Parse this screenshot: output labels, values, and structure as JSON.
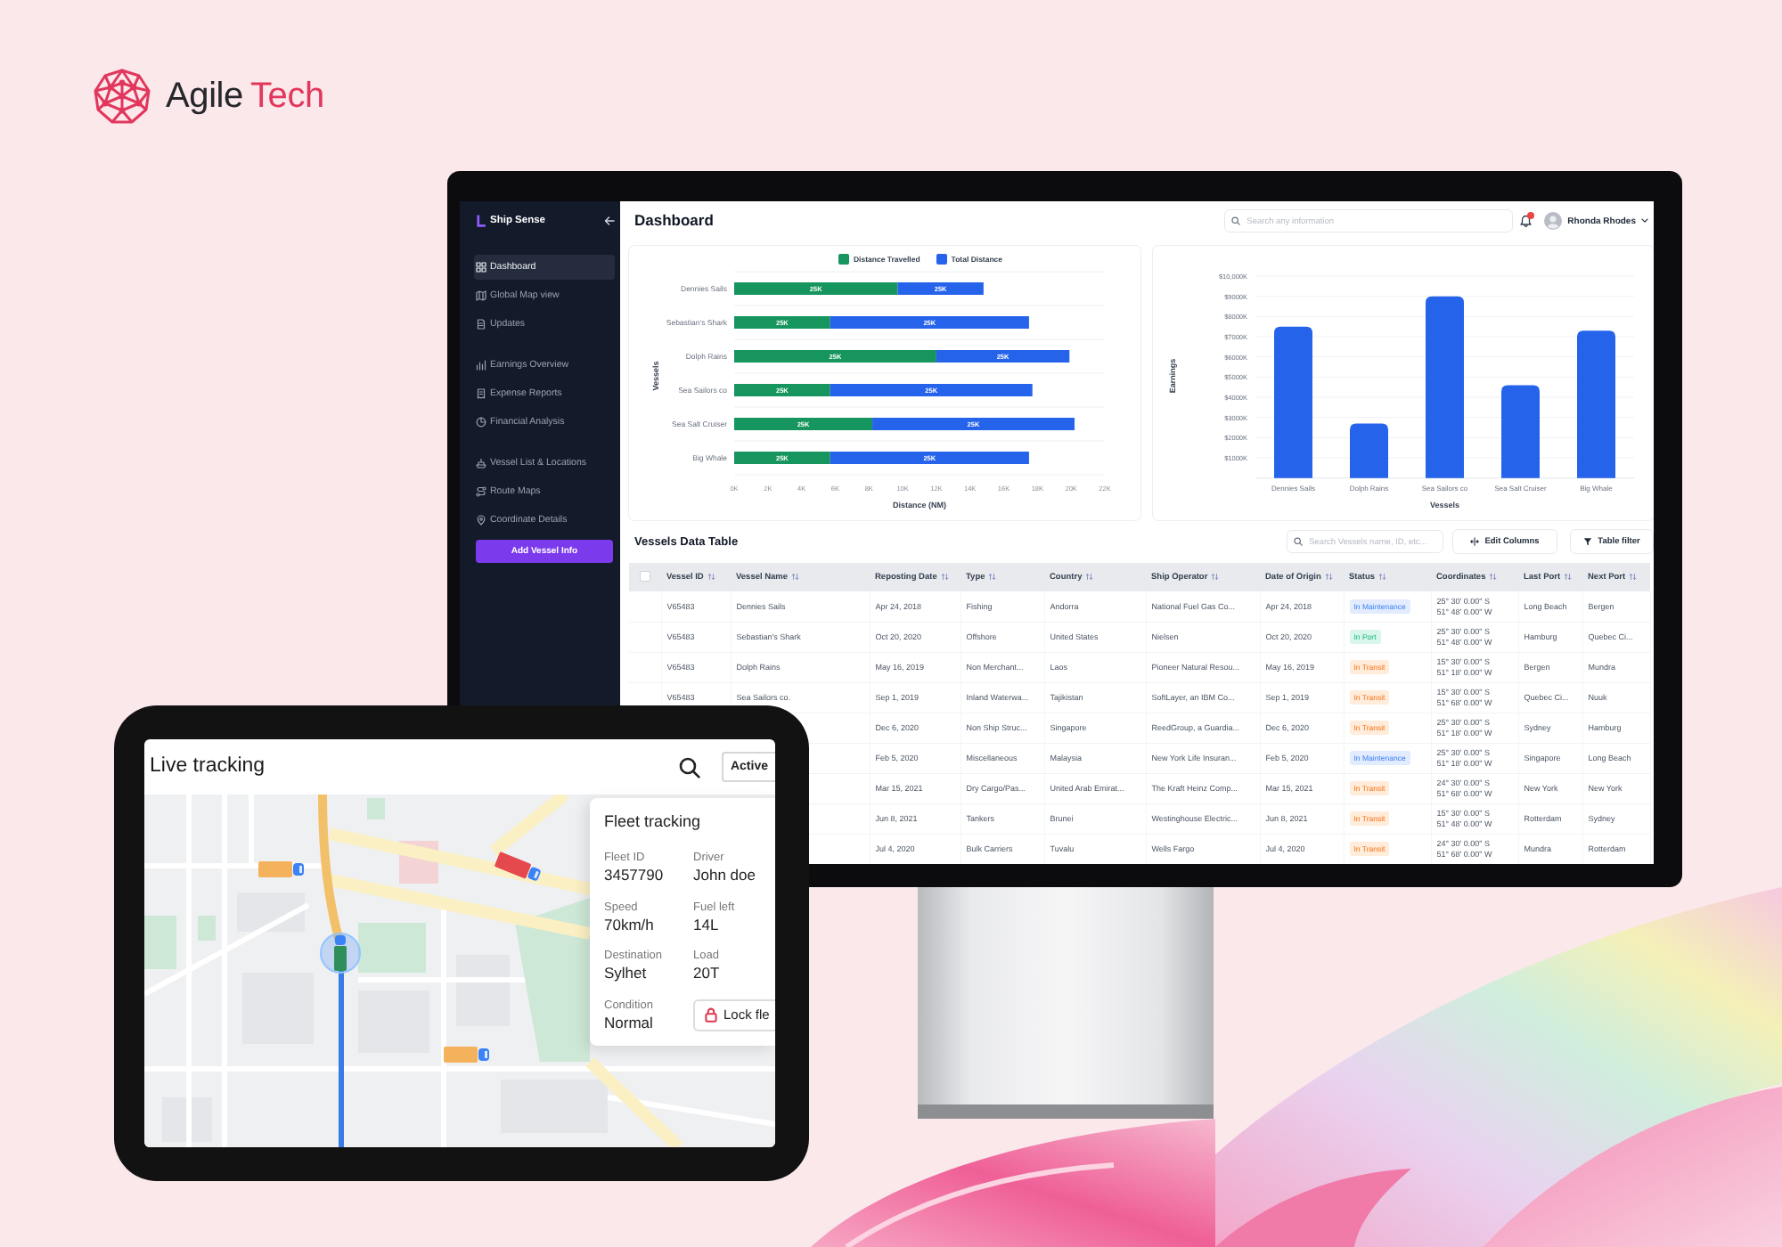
{
  "logo": {
    "words": [
      {
        "text": "Agile",
        "accent": false
      },
      {
        "text": "Tech",
        "accent": true
      }
    ]
  },
  "monitor": {
    "sidebar": {
      "title": "Ship Sense",
      "groups": [
        [
          {
            "label": "Dashboard",
            "selected": true
          },
          {
            "label": "Global Map view",
            "selected": false
          },
          {
            "label": "Updates",
            "selected": false
          }
        ],
        [
          {
            "label": "Earnings Overview",
            "selected": false
          },
          {
            "label": "Expense Reports",
            "selected": false
          },
          {
            "label": "Financial Analysis",
            "selected": false
          }
        ],
        [
          {
            "label": "Vessel List & Locations",
            "selected": false
          },
          {
            "label": "Route Maps",
            "selected": false
          },
          {
            "label": "Coordinate Details",
            "selected": false
          }
        ]
      ],
      "button": "Add Vessel Info"
    },
    "header": {
      "title": "Dashboard",
      "search": {
        "placeholder": "Search any information"
      },
      "notifications": {
        "unread": true
      },
      "user": {
        "name": "Rhonda Rhodes"
      }
    },
    "distance_chart": {
      "chart_data": {
        "type": "bar",
        "orientation": "horizontal",
        "stacked": true,
        "legend": "top",
        "grid": true,
        "xlabel": "Distance (NM)",
        "ylabel": "Vessels",
        "categories": [
          "Dennies Sails",
          "Sebastian's Shark",
          "Dolph Rains",
          "Sea Sailors co",
          "Sea Salt Cruiser",
          "Big Whale"
        ],
        "series": [
          {
            "name": "Distance Travelled",
            "color": "#16955e",
            "values": [
              9.7,
              5.7,
              12,
              5.7,
              8.2,
              5.7
            ]
          },
          {
            "name": "Total Distance",
            "color": "#2563eb",
            "values": [
              5.1,
              11.8,
              7.9,
              12,
              12,
              11.8
            ]
          }
        ],
        "xlim": [
          0,
          22
        ],
        "xticks": [
          {
            "value": 0,
            "label": "0K"
          },
          {
            "value": 2,
            "label": "2K"
          },
          {
            "value": 4,
            "label": "4K"
          },
          {
            "value": 6,
            "label": "6K"
          },
          {
            "value": 8,
            "label": "8K"
          },
          {
            "value": 10,
            "label": "10K"
          },
          {
            "value": 12,
            "label": "12K"
          },
          {
            "value": 14,
            "label": "14K"
          },
          {
            "value": 16,
            "label": "16K"
          },
          {
            "value": 18,
            "label": "18K"
          },
          {
            "value": 20,
            "label": "20K"
          },
          {
            "value": 22,
            "label": "22K"
          }
        ],
        "value_labels": [
          [
            "25K",
            "25K",
            "25K",
            "25K",
            "25K",
            "25K"
          ],
          [
            "25K",
            "25K",
            "25K",
            "25K",
            "25K",
            "25K"
          ]
        ]
      }
    },
    "earnings_chart": {
      "chart_data": {
        "type": "bar",
        "grid": true,
        "xlabel": "Vessels",
        "ylabel": "Earnings",
        "categories": [
          "Dennies Sails",
          "Dolph Rains",
          "Sea Sailors co",
          "Sea Salt Cruiser",
          "Big Whale"
        ],
        "series": [
          {
            "color": "#2563eb",
            "values": [
              7500,
              2700,
              9000,
              4600,
              7300
            ]
          }
        ],
        "ylim": [
          0,
          10000
        ],
        "yticks": [
          {
            "value": 1000,
            "label": "$1000K"
          },
          {
            "value": 2000,
            "label": "$2000K"
          },
          {
            "value": 3000,
            "label": "$3000K"
          },
          {
            "value": 4000,
            "label": "$4000K"
          },
          {
            "value": 5000,
            "label": "$5000K"
          },
          {
            "value": 6000,
            "label": "$6000K"
          },
          {
            "value": 7000,
            "label": "$7000K"
          },
          {
            "value": 8000,
            "label": "$8000K"
          },
          {
            "value": 9000,
            "label": "$9000K"
          },
          {
            "value": 10000,
            "label": "$10,000K"
          }
        ]
      }
    },
    "vessels_table": {
      "title": "Vessels Data Table",
      "search": {
        "placeholder": "Search Vessels name, ID, etc..."
      },
      "buttons": [
        {
          "label": "Edit Columns",
          "kind": "columns"
        },
        {
          "label": "Table filter",
          "kind": "filter"
        }
      ],
      "select_all": {
        "checked": false
      },
      "columns": [
        "Vessel ID",
        "Vessel Name",
        "Reposting Date",
        "Type",
        "Country",
        "Ship Operator",
        "Date of Origin",
        "Status",
        "Coordinates",
        "Last Port",
        "Next Port"
      ],
      "rows": [
        {
          "vessel_id": "V65483",
          "vessel_name": "Dennies Sails",
          "reposting_date": "Apr 24, 2018",
          "type": "Fishing",
          "country": "Andorra",
          "ship_operator": "National Fuel Gas Co...",
          "date_of_origin": "Apr 24, 2018",
          "status": {
            "text": "In Maintenance",
            "kind": "maintenance"
          },
          "coordinates": [
            "25° 30' 0.00\" S",
            "51° 48' 0.00\" W"
          ],
          "last_port": "Long Beach",
          "next_port": "Bergen"
        },
        {
          "vessel_id": "V65483",
          "vessel_name": "Sebastian's Shark",
          "reposting_date": "Oct 20, 2020",
          "type": "Offshore",
          "country": "United States",
          "ship_operator": "Nielsen",
          "date_of_origin": "Oct 20, 2020",
          "status": {
            "text": "In Port",
            "kind": "port"
          },
          "coordinates": [
            "25° 30' 0.00\" S",
            "51° 48' 0.00\" W"
          ],
          "last_port": "Hamburg",
          "next_port": "Quebec Ci..."
        },
        {
          "vessel_id": "V65483",
          "vessel_name": "Dolph Rains",
          "reposting_date": "May 16, 2019",
          "type": "Non Merchant...",
          "country": "Laos",
          "ship_operator": "Pioneer Natural Resou...",
          "date_of_origin": "May 16, 2019",
          "status": {
            "text": "In Transit",
            "kind": "transit"
          },
          "coordinates": [
            "15° 30' 0.00\" S",
            "51° 18' 0.00\" W"
          ],
          "last_port": "Bergen",
          "next_port": "Mundra"
        },
        {
          "vessel_id": "V65483",
          "vessel_name": "Sea Sailors co.",
          "reposting_date": "Sep 1, 2019",
          "type": "Inland Waterwa...",
          "country": "Tajikistan",
          "ship_operator": "SoftLayer, an IBM Co...",
          "date_of_origin": "Sep 1, 2019",
          "status": {
            "text": "In Transit",
            "kind": "transit"
          },
          "coordinates": [
            "15° 30' 0.00\" S",
            "51° 68' 0.00\" W"
          ],
          "last_port": "Quebec Ci...",
          "next_port": "Nuuk"
        },
        {
          "reposting_date": "Dec 6, 2020",
          "type": "Non Ship Struc...",
          "country": "Singapore",
          "ship_operator": "ReedGroup, a Guardia...",
          "date_of_origin": "Dec 6, 2020",
          "status": {
            "text": "In Transit",
            "kind": "transit"
          },
          "coordinates": [
            "25° 30' 0.00\" S",
            "51° 18' 0.00\" W"
          ],
          "last_port": "Sydney",
          "next_port": "Hamburg"
        },
        {
          "reposting_date": "Feb 5, 2020",
          "type": "Miscellaneous",
          "country": "Malaysia",
          "ship_operator": "New York Life Insuran...",
          "date_of_origin": "Feb 5, 2020",
          "status": {
            "text": "In Maintenance",
            "kind": "maintenance"
          },
          "coordinates": [
            "25° 30' 0.00\" S",
            "51° 18' 0.00\" W"
          ],
          "last_port": "Singapore",
          "next_port": "Long Beach"
        },
        {
          "reposting_date": "Mar 15, 2021",
          "type": "Dry Cargo/Pas...",
          "country": "United Arab Emirat...",
          "ship_operator": "The Kraft Heinz Comp...",
          "date_of_origin": "Mar 15, 2021",
          "status": {
            "text": "In Transit",
            "kind": "transit"
          },
          "coordinates": [
            "24° 30' 0.00\" S",
            "51° 68' 0.00\" W"
          ],
          "last_port": "New York",
          "next_port": "New York"
        },
        {
          "reposting_date": "Jun 8, 2021",
          "type": "Tankers",
          "country": "Brunei",
          "ship_operator": "Westinghouse Electric...",
          "date_of_origin": "Jun 8, 2021",
          "status": {
            "text": "In Transit",
            "kind": "transit"
          },
          "coordinates": [
            "15° 30' 0.00\" S",
            "51° 48' 0.00\" W"
          ],
          "last_port": "Rotterdam",
          "next_port": "Sydney"
        },
        {
          "reposting_date": "Jul 4, 2020",
          "type": "Bulk Carriers",
          "country": "Tuvalu",
          "ship_operator": "Wells Fargo",
          "date_of_origin": "Jul 4, 2020",
          "status": {
            "text": "In Transit",
            "kind": "transit"
          },
          "coordinates": [
            "24° 30' 0.00\" S",
            "51° 68' 0.00\" W"
          ],
          "last_port": "Mundra",
          "next_port": "Rotterdam"
        }
      ]
    }
  },
  "tablet": {
    "title": "Live tracking",
    "status_button": "Active",
    "fleet_panel": {
      "title": "Fleet tracking",
      "fields": [
        {
          "label": "Fleet ID",
          "value": "3457790"
        },
        {
          "label": "Driver",
          "value": "John doe"
        },
        {
          "label": "Speed",
          "value": "70km/h"
        },
        {
          "label": "Fuel left",
          "value": "14L"
        },
        {
          "label": "Destination",
          "value": "Sylhet"
        },
        {
          "label": "Load",
          "value": "20T"
        },
        {
          "label": "Condition",
          "value": "Normal"
        }
      ],
      "button": "Lock fle"
    }
  }
}
